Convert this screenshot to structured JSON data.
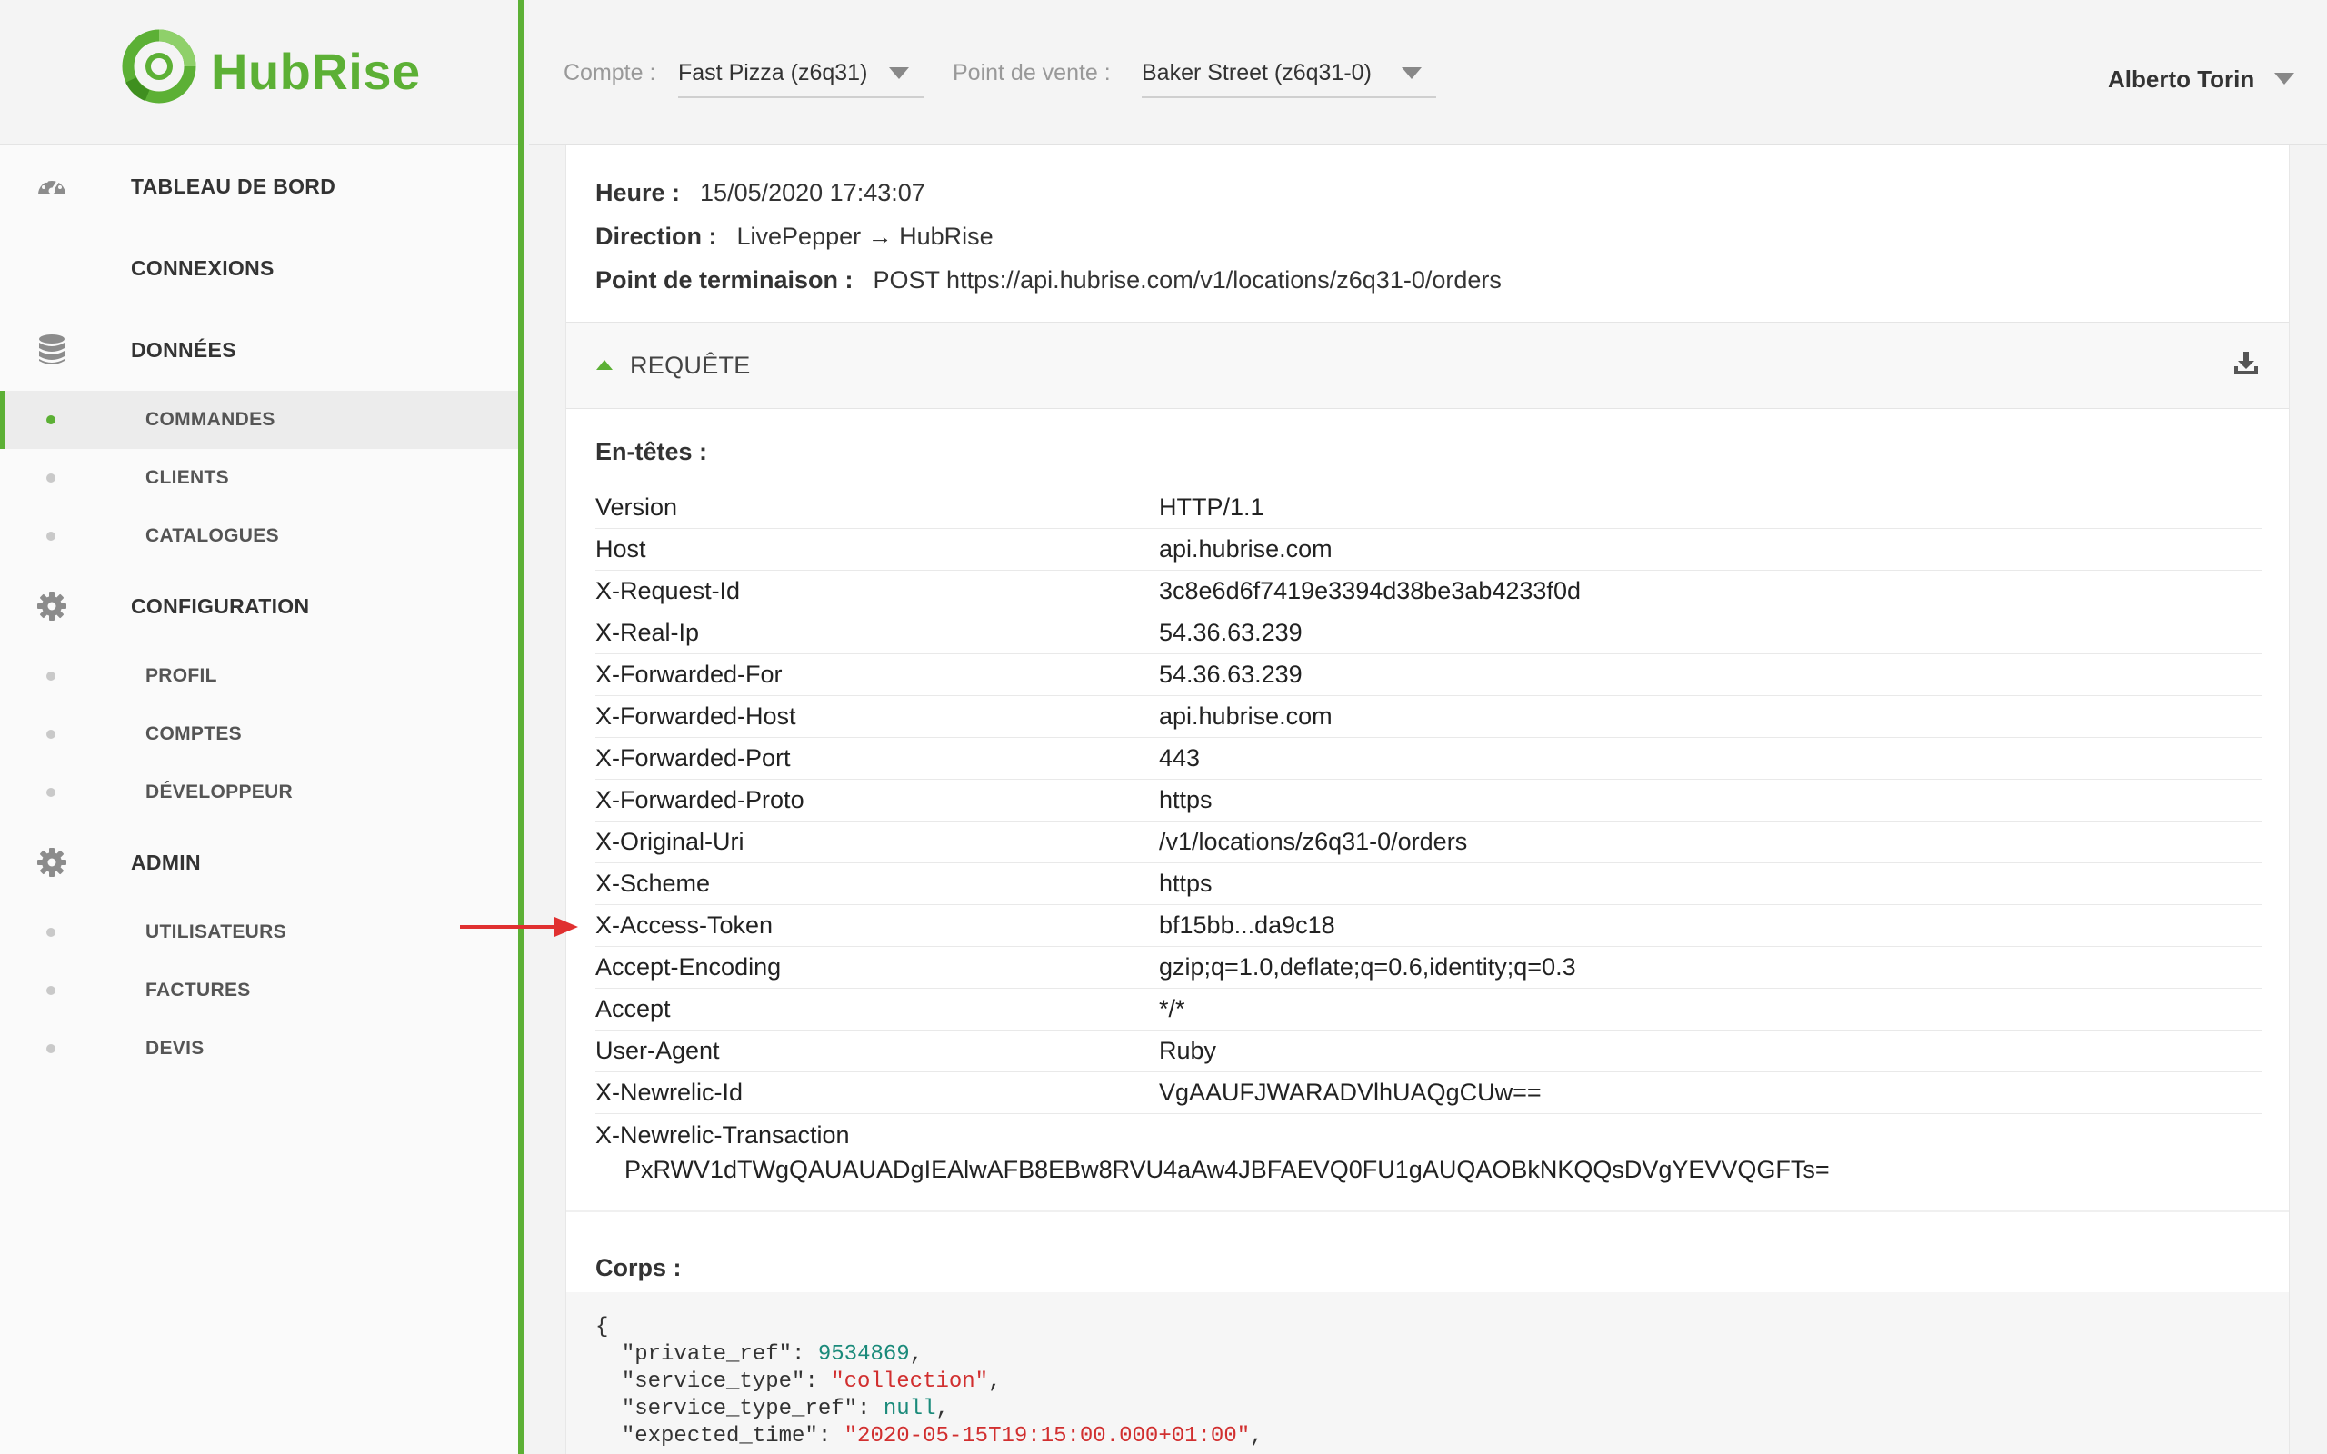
{
  "brand": {
    "name": "HubRise",
    "color": "#5cb035"
  },
  "header": {
    "account_label": "Compte :",
    "account_value": "Fast Pizza (z6q31)",
    "location_label": "Point de vente :",
    "location_value": "Baker Street (z6q31-0)",
    "user_name": "Alberto Torin"
  },
  "sidebar": {
    "dashboard": "TABLEAU DE BORD",
    "connections": "CONNEXIONS",
    "data": {
      "label": "DONNÉES",
      "items": [
        "COMMANDES",
        "CLIENTS",
        "CATALOGUES"
      ]
    },
    "configuration": {
      "label": "CONFIGURATION",
      "items": [
        "PROFIL",
        "COMPTES",
        "DÉVELOPPEUR"
      ]
    },
    "admin": {
      "label": "ADMIN",
      "items": [
        "UTILISATEURS",
        "FACTURES",
        "DEVIS"
      ]
    }
  },
  "log": {
    "time_label": "Heure :",
    "time_value": "15/05/2020 17:43:07",
    "direction_label": "Direction :",
    "direction_value": "LivePepper → HubRise",
    "endpoint_label": "Point de terminaison :",
    "endpoint_value": "POST https://api.hubrise.com/v1/locations/z6q31-0/orders",
    "request_label": "REQUÊTE",
    "headers_title": "En-têtes :",
    "body_title": "Corps :",
    "headers": [
      [
        "Version",
        "HTTP/1.1"
      ],
      [
        "Host",
        "api.hubrise.com"
      ],
      [
        "X-Request-Id",
        "3c8e6d6f7419e3394d38be3ab4233f0d"
      ],
      [
        "X-Real-Ip",
        "54.36.63.239"
      ],
      [
        "X-Forwarded-For",
        "54.36.63.239"
      ],
      [
        "X-Forwarded-Host",
        "api.hubrise.com"
      ],
      [
        "X-Forwarded-Port",
        "443"
      ],
      [
        "X-Forwarded-Proto",
        "https"
      ],
      [
        "X-Original-Uri",
        "/v1/locations/z6q31-0/orders"
      ],
      [
        "X-Scheme",
        "https"
      ],
      [
        "X-Access-Token",
        "bf15bb...da9c18"
      ],
      [
        "Accept-Encoding",
        "gzip;q=1.0,deflate;q=0.6,identity;q=0.3"
      ],
      [
        "Accept",
        "*/*"
      ],
      [
        "User-Agent",
        "Ruby"
      ],
      [
        "X-Newrelic-Id",
        "VgAAUFJWARADVlhUAQgCUw=="
      ]
    ],
    "last_header_key": "X-Newrelic-Transaction",
    "last_header_value": "PxRWV1dTWgQAUAUADgIEAlwAFB8EBw8RVU4aAw4JBFAEVQ0FU1gAUQAOBkNKQQsDVgYEVVQGFTs=",
    "body": {
      "open": "{",
      "l1_key": "\"private_ref\": ",
      "l1_val": "9534869",
      "l2_key": "\"service_type\": ",
      "l2_val": "\"collection\"",
      "l3_key": "\"service_type_ref\": ",
      "l3_val": "null",
      "l4_key": "\"expected_time\": ",
      "l4_val": "\"2020-05-15T19:15:00.000+01:00\""
    }
  }
}
